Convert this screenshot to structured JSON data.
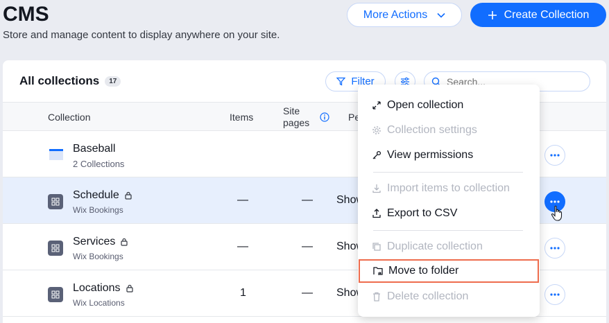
{
  "header": {
    "title": "CMS",
    "subtitle": "Store and manage content to display anywhere on your site.",
    "more_actions": "More Actions",
    "create": "Create Collection"
  },
  "card": {
    "title": "All collections",
    "count": "17",
    "filter": "Filter",
    "search_placeholder": "Search..."
  },
  "table": {
    "columns": {
      "collection": "Collection",
      "items": "Items",
      "site_pages_1": "Site",
      "site_pages_2": "pages",
      "permissions": "Pe"
    },
    "rows": [
      {
        "name": "Baseball",
        "sub": "2 Collections",
        "items": "",
        "pages": "",
        "perm": ""
      },
      {
        "name": "Schedule",
        "sub": "Wix Bookings",
        "items": "—",
        "pages": "—",
        "perm": "Show"
      },
      {
        "name": "Services",
        "sub": "Wix Bookings",
        "items": "—",
        "pages": "—",
        "perm": "Show"
      },
      {
        "name": "Locations",
        "sub": "Wix Locations",
        "items": "1",
        "pages": "—",
        "perm": "Show"
      }
    ]
  },
  "menu": {
    "items": [
      {
        "label": "Open collection",
        "icon": "expand-icon",
        "disabled": false
      },
      {
        "label": "Collection settings",
        "icon": "gear-icon",
        "disabled": true
      },
      {
        "label": "View permissions",
        "icon": "key-icon",
        "disabled": false
      },
      {
        "label": "Import items to collection",
        "icon": "import-icon",
        "disabled": true
      },
      {
        "label": "Export to CSV",
        "icon": "export-icon",
        "disabled": false
      },
      {
        "label": "Duplicate collection",
        "icon": "duplicate-icon",
        "disabled": true
      },
      {
        "label": "Move to folder",
        "icon": "folder-move-icon",
        "disabled": false,
        "highlighted": true
      },
      {
        "label": "Delete collection",
        "icon": "trash-icon",
        "disabled": true
      }
    ]
  },
  "colors": {
    "accent": "#116dff",
    "highlight_row": "#e7effd",
    "selection_border": "#ee6c4d",
    "disabled_text": "#b2b6c0"
  }
}
